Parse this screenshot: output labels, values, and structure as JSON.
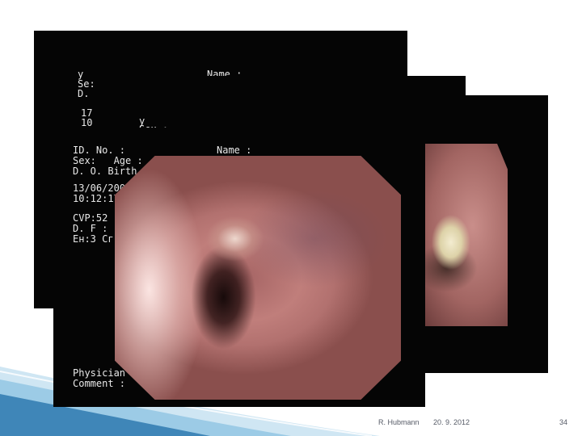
{
  "slide": {
    "colors": {
      "background": "#ffffff",
      "panel": "#050505",
      "overlay_text": "#e8e8e8",
      "footer_text": "#555a66",
      "swoosh_light": "#cfe6f3",
      "swoosh_dark": "#3f86b8"
    },
    "footer": {
      "author": "R. Hubmann",
      "date": "20. 9. 2012",
      "page_number": "34"
    }
  },
  "back_panel": {
    "line1": "y",
    "line2": "Se:",
    "line3": "D.",
    "name_label": "Name :",
    "date_partial": "17",
    "time_partial": "10",
    "mid_y": "y",
    "mid_sex": "Sex :"
  },
  "front_panel": {
    "id_label": "ID. No. :",
    "name_label": "Name :",
    "sex_age_label": "Sex:   Age :",
    "dob_label": "D. O. Birth :",
    "date": "13/06/2006",
    "time": "10:12:17",
    "cvp": "CVP:52",
    "df": "D. F :",
    "eh": "Eн:3 Сг:Н",
    "physician_label": "Physician :",
    "comment_label": "Comment :"
  }
}
